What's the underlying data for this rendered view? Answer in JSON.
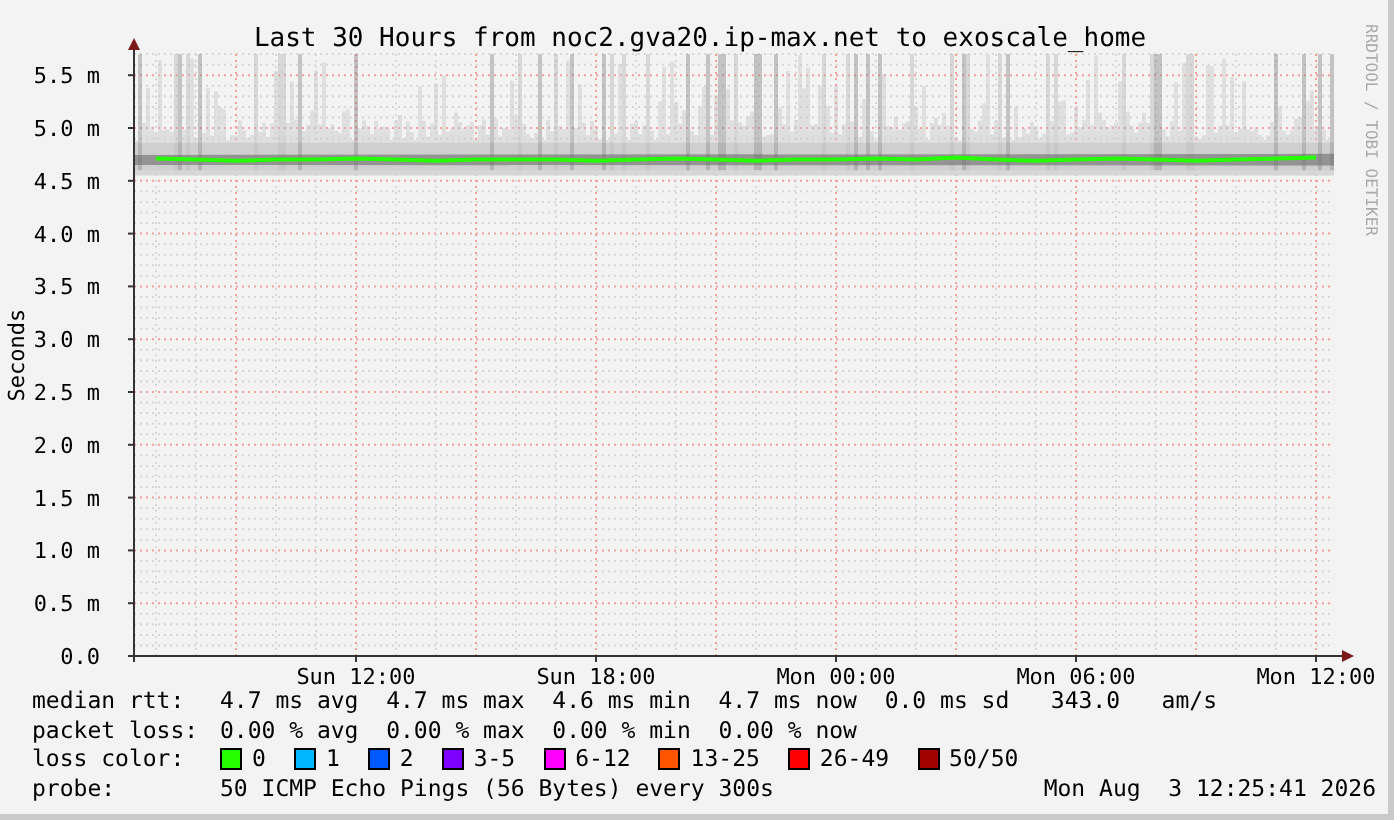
{
  "graph": {
    "watermark": "RRDTOOL / TOBI OETIKER",
    "chart_data": {
      "type": "line",
      "title": "Last 30 Hours from noc2.gva20.ip-max.net to exoscale_home",
      "ylabel": "Seconds",
      "categories": [
        null,
        null,
        null,
        null,
        null,
        "Sun 12:00",
        null,
        null,
        null,
        null,
        null,
        "Sun 18:00",
        null,
        null,
        null,
        null,
        null,
        "Mon 00:00",
        null,
        null,
        null,
        null,
        null,
        "Mon 06:00",
        null,
        null,
        null,
        null,
        null,
        "Mon 12:00"
      ],
      "series": [
        {
          "name": "median rtt:",
          "color": "#26ff00",
          "values": [
            4.71,
            4.7,
            4.69,
            4.7,
            4.7,
            4.71,
            4.7,
            4.69,
            4.7,
            4.7,
            4.7,
            4.69,
            4.7,
            4.71,
            4.7,
            4.69,
            4.7,
            4.7,
            4.71,
            4.7,
            4.72,
            4.7,
            4.69,
            4.7,
            4.71,
            4.7,
            4.69,
            4.7,
            4.71,
            4.72
          ]
        }
      ],
      "ylim": [
        0,
        5.7
      ],
      "grid": true,
      "yticks": [
        {
          "value": 0,
          "label": "0.0"
        },
        {
          "value": 0.5,
          "label": "0.5 m"
        },
        {
          "value": 1,
          "label": "1.0 m"
        },
        {
          "value": 1.5,
          "label": "1.5 m"
        },
        {
          "value": 2,
          "label": "2.0 m"
        },
        {
          "value": 2.5,
          "label": "2.5 m"
        },
        {
          "value": 3,
          "label": "3.0 m"
        },
        {
          "value": 3.5,
          "label": "3.5 m"
        },
        {
          "value": 4,
          "label": "4.0 m"
        },
        {
          "value": 4.5,
          "label": "4.5 m"
        },
        {
          "value": 5,
          "label": "5.0 m"
        },
        {
          "value": 5.5,
          "label": "5.5 m"
        }
      ]
    }
  },
  "legend": {
    "rows": [
      {
        "text": "4.7 ms avg  4.7 ms max  4.6 ms min  4.7 ms now  0.0 ms sd   343.0   am/s"
      },
      {
        "label": "packet loss:",
        "text": "0.00 % avg  0.00 % max  0.00 % min  0.00 % now"
      }
    ],
    "loss_color": {
      "label": "loss color:",
      "items": [
        {
          "label": "0",
          "color": "#26ff00"
        },
        {
          "label": "1",
          "color": "#00b8ff"
        },
        {
          "label": "2",
          "color": "#0059ff"
        },
        {
          "label": "3-5",
          "color": "#7e00ff"
        },
        {
          "label": "6-12",
          "color": "#ff00ff"
        },
        {
          "label": "13-25",
          "color": "#ff5500"
        },
        {
          "label": "26-49",
          "color": "#ff0000"
        },
        {
          "label": "50/50",
          "color": "#a10000"
        }
      ]
    },
    "probe": {
      "label": "probe:",
      "text": "50 ICMP Echo Pings (56 Bytes) every 300s",
      "timestamp": "Mon Aug  3 12:25:41 2026"
    }
  }
}
